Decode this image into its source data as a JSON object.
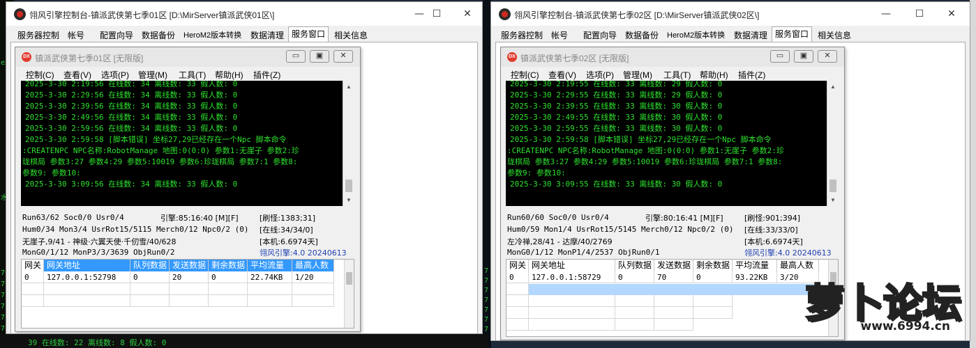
{
  "windows": [
    {
      "title": "翎风引擎控制台-镇派武侠第七季01区 [D:\\MirServer镇派武侠01区\\]",
      "tabs": [
        "服务器控制",
        "帐号",
        "配置向导",
        "数据备份",
        "HeroM2版本转换",
        "数据清理",
        "服务窗口",
        "相关信息"
      ],
      "active_tab": "服务窗口",
      "inner_title": "镇派武侠第七季01区 [无限版]",
      "menu": [
        "控制(C)",
        "查看(V)",
        "选项(P)",
        "管理(M)",
        "工具(T)",
        "帮助(H)",
        "插件(Z)"
      ],
      "log": [
        "2025-3-30 2:19:56 在线数: 34 离线数: 33 假人数: 0",
        "2025-3-30 2:29:56 在线数: 34 离线数: 33 假人数: 0",
        "2025-3-30 2:39:56 在线数: 34 离线数: 33 假人数: 0",
        "2025-3-30 2:49:56 在线数: 34 离线数: 33 假人数: 0",
        "2025-3-30 2:59:56 在线数: 34 离线数: 33 假人数: 0",
        "2025-3-30 2:59:58 [脚本错误] 坐标27,29已经存在一个Npc 脚本命令",
        ":CREATENPC NPC名称:RobotManage 地图:0(0:0) 参数1:无崖子 参数2:珍",
        "珑棋局 参数3:27 参数4:29 参数5:10019 参数6:珍珑棋局 参数7:1 参数8:",
        "参数9: 参数10:",
        "2025-3-30 3:09:56 在线数: 34 离线数: 33 假人数: 0"
      ],
      "stats": {
        "run": "Run63/62 Soc0/0 Usr0/4",
        "engine_time": "引擎:85:16:40 [M][F]",
        "refresh": "[刷怪:1383;31]",
        "hum": "Hum0/34 Mon3/4 UsrRot15/5115 Merch0/12 Npc0/2 (0)",
        "online": "[在线:34/34/0]",
        "player": "无崖子,9/41 - 神级·六翼天使·千仞雪/40/628",
        "machine": "[本机:6.6974天]",
        "mon": "MonG0/1/12 MonP3/3/3639 ObjRun0/2",
        "engine_version": "翎风引擎:4.0 20240613"
      },
      "grid": {
        "headers": [
          "网关",
          "网关地址",
          "队列数据",
          "发送数据",
          "剩余数据",
          "平均流量",
          "最高人数"
        ],
        "highlighted_headers": [
          1,
          2,
          3,
          4,
          5,
          6
        ],
        "rows": [
          [
            "0",
            "127.0.0.1:52798",
            "0",
            "20",
            "0",
            "22.74KB",
            "1/20"
          ]
        ]
      }
    },
    {
      "title": "翎风引擎控制台-镇派武侠第七季02区 [D:\\MirServer镇派武侠02区\\]",
      "tabs": [
        "服务器控制",
        "帐号",
        "配置向导",
        "数据备份",
        "HeroM2版本转换",
        "数据清理",
        "服务窗口",
        "相关信息"
      ],
      "active_tab": "服务窗口",
      "inner_title": "镇派武侠第七季02区 [无限版]",
      "menu": [
        "控制(C)",
        "查看(V)",
        "选项(P)",
        "管理(M)",
        "工具(T)",
        "帮助(H)",
        "插件(Z)"
      ],
      "log": [
        "2025-3-30 2:19:55 在线数: 33 离线数: 29 假人数: 0",
        "2025-3-30 2:29:55 在线数: 33 离线数: 29 假人数: 0",
        "2025-3-30 2:39:55 在线数: 33 离线数: 30 假人数: 0",
        "2025-3-30 2:49:55 在线数: 33 离线数: 30 假人数: 0",
        "2025-3-30 2:59:55 在线数: 33 离线数: 30 假人数: 0",
        "2025-3-30 2:59:58 [脚本错误] 坐标27,29已经存在一个Npc 脚本命令",
        ":CREATENPC NPC名称:RobotManage 地图:0(0:0) 参数1:无崖子 参数2:珍",
        "珑棋局 参数3:27 参数4:29 参数5:10019 参数6:珍珑棋局 参数7:1 参数8:",
        "参数9: 参数10:",
        "2025-3-30 3:09:55 在线数: 33 离线数: 30 假人数: 0"
      ],
      "stats": {
        "run": "Run60/60 Soc0/0 Usr0/4",
        "engine_time": "引擎:80:16:41 [M][F]",
        "refresh": "[刷怪:901;394]",
        "hum": "Hum0/59 Mon1/4 UsrRot15/5145 Merch0/12 Npc0/2 (0)",
        "online": "[在线:33/33/0]",
        "player": "左冷禅,28/41 - 达摩/40/2769",
        "machine": "[本机:6.6974天]",
        "mon": "MonG0/1/12 MonP1/4/2537 ObjRun0/1",
        "engine_version": "翎风引擎:4.0 20240613"
      },
      "grid": {
        "headers": [
          "网关",
          "网关地址",
          "队列数据",
          "发送数据",
          "剩余数据",
          "平均流量",
          "最高人数"
        ],
        "highlighted_headers": [],
        "rows": [
          [
            "0",
            "127.0.0.1:58729",
            "0",
            "70",
            "0",
            "93.22KB",
            "3/20"
          ]
        ]
      }
    }
  ],
  "window_controls": [
    "—",
    "☐",
    "✕"
  ],
  "inner_controls": [
    "▭",
    "▣",
    "✕"
  ],
  "watermark": {
    "logo": "萝卜论坛",
    "url": "www.6994.cn"
  },
  "desktop": {
    "left_glyphs": [
      "ex",
      "水",
      "7",
      "7",
      "7",
      "7",
      "7",
      "7"
    ],
    "gap_glyphs": [
      "7",
      "7",
      "7",
      "7",
      "7",
      "7",
      "7",
      "7"
    ],
    "bottom_text": "39 在线数: 22 离线数: 8 假人数: 0"
  }
}
